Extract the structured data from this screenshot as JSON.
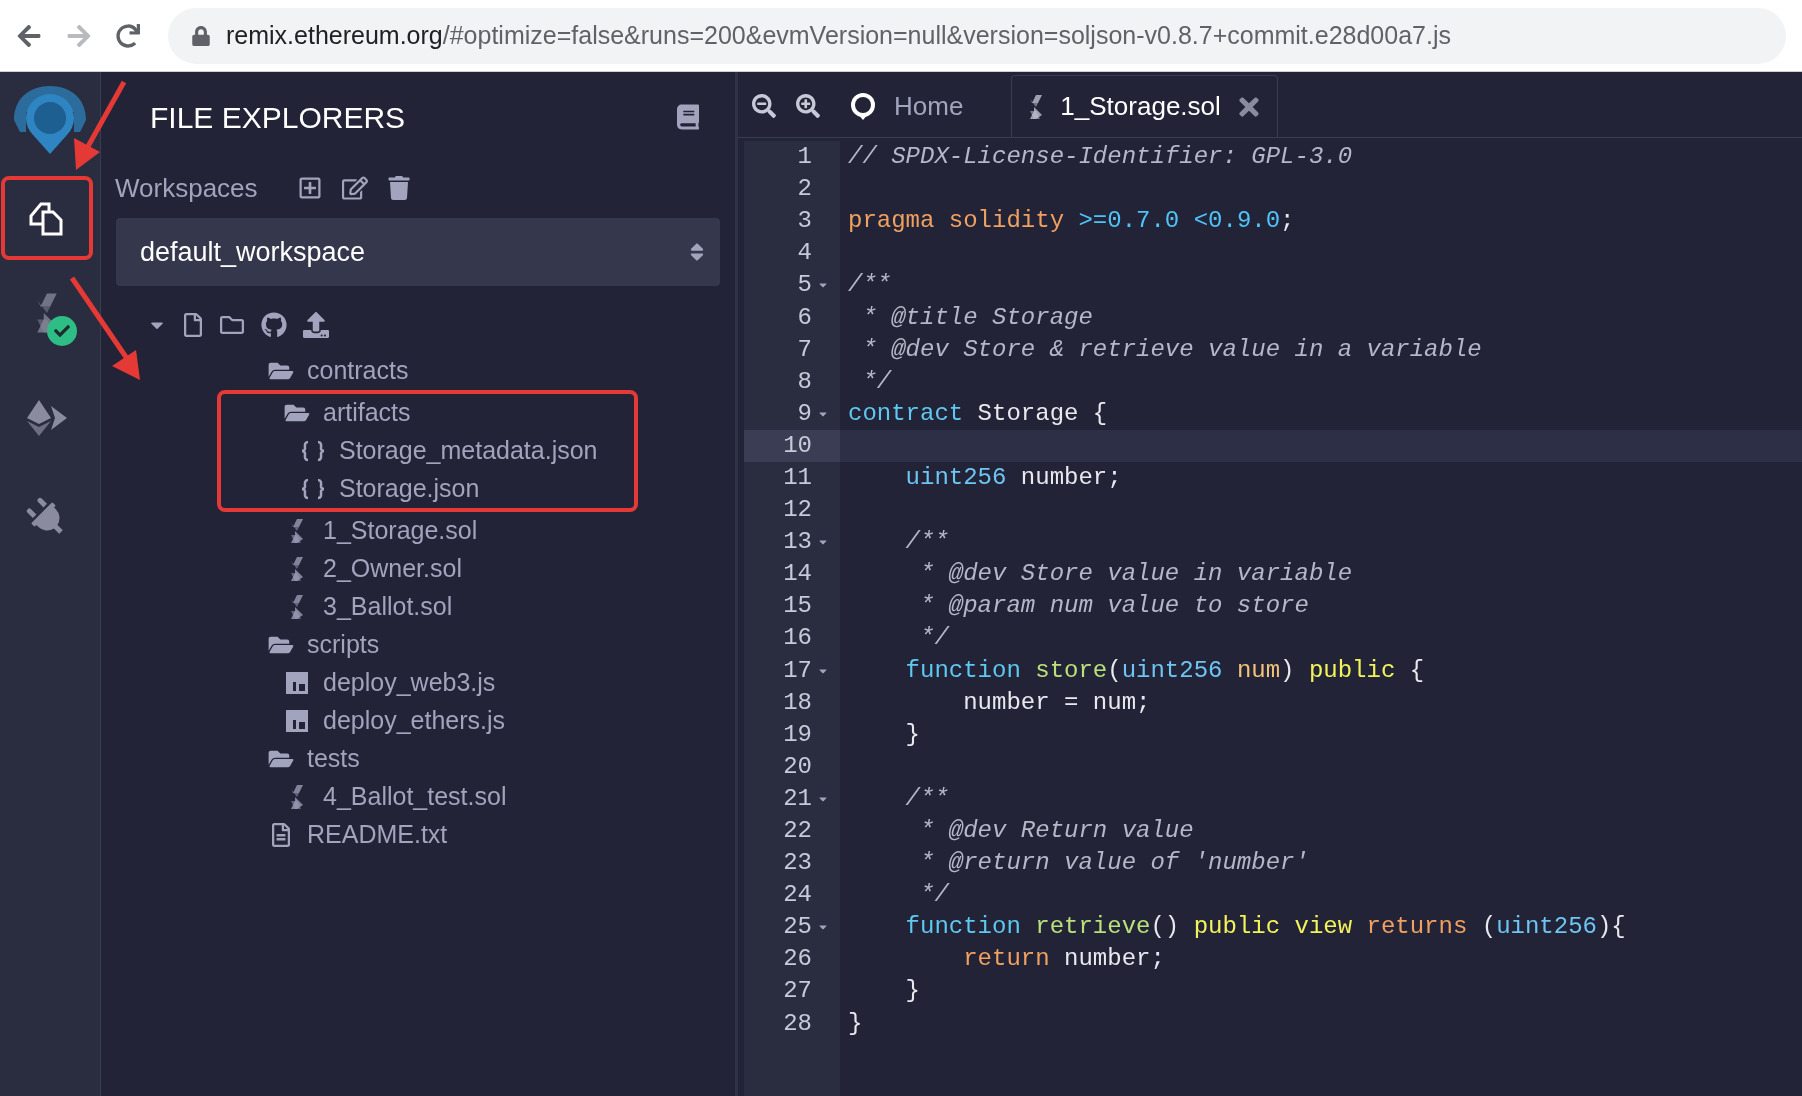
{
  "browser": {
    "url_host": "remix.ethereum.org",
    "url_rest": "/#optimize=false&runs=200&evmVersion=null&version=soljson-v0.8.7+commit.e28d00a7.js",
    "forward_disabled": true
  },
  "activity_bar": [
    {
      "kind": "files",
      "selected": true,
      "highlighted": true
    },
    {
      "kind": "compiler",
      "selected": false,
      "highlighted": false,
      "compiled": true
    },
    {
      "kind": "deploy",
      "selected": false,
      "highlighted": false
    },
    {
      "kind": "plugins",
      "selected": false,
      "highlighted": false
    }
  ],
  "side_panel": {
    "title": "FILE EXPLORERS",
    "workspaces_label": "Workspaces",
    "workspace": "default_workspace",
    "tree": [
      {
        "name": "contracts",
        "kind": "folder",
        "expanded": true,
        "highlighted": false,
        "children": [
          {
            "name": "artifacts",
            "kind": "folder",
            "expanded": true,
            "highlighted": true,
            "children": [
              {
                "name": "Storage_metadata.json",
                "kind": "json",
                "highlighted": false
              },
              {
                "name": "Storage.json",
                "kind": "json",
                "highlighted": false
              }
            ]
          },
          {
            "name": "1_Storage.sol",
            "kind": "sol",
            "highlighted": false
          },
          {
            "name": "2_Owner.sol",
            "kind": "sol",
            "highlighted": false
          },
          {
            "name": "3_Ballot.sol",
            "kind": "sol",
            "highlighted": false
          }
        ]
      },
      {
        "name": "scripts",
        "kind": "folder",
        "expanded": true,
        "highlighted": false,
        "children": [
          {
            "name": "deploy_web3.js",
            "kind": "js",
            "highlighted": false
          },
          {
            "name": "deploy_ethers.js",
            "kind": "js",
            "highlighted": false
          }
        ]
      },
      {
        "name": "tests",
        "kind": "folder",
        "expanded": true,
        "highlighted": false,
        "children": [
          {
            "name": "4_Ballot_test.sol",
            "kind": "sol",
            "highlighted": false
          }
        ]
      },
      {
        "name": "README.txt",
        "kind": "txt",
        "highlighted": false
      }
    ]
  },
  "tabs": [
    {
      "label": "Home",
      "kind": "home",
      "selected": false
    },
    {
      "label": "1_Storage.sol",
      "kind": "sol",
      "selected": true
    }
  ],
  "code": [
    {
      "number": "1",
      "foldable": false,
      "active": false,
      "tokens": [
        {
          "kind": "comment",
          "text": "// SPDX-License-Identifier: GPL-3.0"
        }
      ]
    },
    {
      "number": "2",
      "foldable": false,
      "active": false
    },
    {
      "number": "3",
      "foldable": false,
      "active": false,
      "tokens": [
        {
          "kind": "keyword",
          "text": "pragma solidity"
        },
        {
          "kind": "literal",
          "text": " >=0.7.0 <0.9.0"
        },
        {
          "kind": "plain",
          "text": ";"
        }
      ]
    },
    {
      "number": "4",
      "foldable": false,
      "active": false
    },
    {
      "number": "5",
      "foldable": true,
      "active": false,
      "tokens": [
        {
          "kind": "comment",
          "text": "/**"
        }
      ]
    },
    {
      "number": "6",
      "foldable": false,
      "active": false,
      "tokens": [
        {
          "kind": "comment",
          "text": " * @title Storage"
        }
      ]
    },
    {
      "number": "7",
      "foldable": false,
      "active": false,
      "tokens": [
        {
          "kind": "comment",
          "text": " * @dev Store & retrieve value in a variable"
        }
      ]
    },
    {
      "number": "8",
      "foldable": false,
      "active": false,
      "tokens": [
        {
          "kind": "comment",
          "text": " */"
        }
      ]
    },
    {
      "number": "9",
      "foldable": true,
      "active": false,
      "tokens": [
        {
          "kind": "storage",
          "text": "contract"
        },
        {
          "kind": "plain",
          "text": " Storage {"
        }
      ]
    },
    {
      "number": "10",
      "foldable": false,
      "active": true
    },
    {
      "number": "11",
      "foldable": false,
      "active": false,
      "tokens": [
        {
          "kind": "type",
          "text": "    uint256"
        },
        {
          "kind": "plain",
          "text": " number;"
        }
      ]
    },
    {
      "number": "12",
      "foldable": false,
      "active": false
    },
    {
      "number": "13",
      "foldable": true,
      "active": false,
      "tokens": [
        {
          "kind": "comment",
          "text": "    /**"
        }
      ]
    },
    {
      "number": "14",
      "foldable": false,
      "active": false,
      "tokens": [
        {
          "kind": "comment",
          "text": "     * @dev Store value in variable"
        }
      ]
    },
    {
      "number": "15",
      "foldable": false,
      "active": false,
      "tokens": [
        {
          "kind": "comment",
          "text": "     * @param num value to store"
        }
      ]
    },
    {
      "number": "16",
      "foldable": false,
      "active": false,
      "tokens": [
        {
          "kind": "comment",
          "text": "     */"
        }
      ]
    },
    {
      "number": "17",
      "foldable": true,
      "active": false,
      "tokens": [
        {
          "kind": "storage",
          "text": "    function"
        },
        {
          "kind": "func",
          "text": " store"
        },
        {
          "kind": "plain",
          "text": "("
        },
        {
          "kind": "type",
          "text": "uint256"
        },
        {
          "kind": "param",
          "text": " num"
        },
        {
          "kind": "plain",
          "text": ")"
        },
        {
          "kind": "modifier",
          "text": " public"
        },
        {
          "kind": "plain",
          "text": " {"
        }
      ]
    },
    {
      "number": "18",
      "foldable": false,
      "active": false,
      "tokens": [
        {
          "kind": "plain",
          "text": "        number = num;"
        }
      ]
    },
    {
      "number": "19",
      "foldable": false,
      "active": false,
      "tokens": [
        {
          "kind": "plain",
          "text": "    }"
        }
      ]
    },
    {
      "number": "20",
      "foldable": false,
      "active": false
    },
    {
      "number": "21",
      "foldable": true,
      "active": false,
      "tokens": [
        {
          "kind": "comment",
          "text": "    /**"
        }
      ]
    },
    {
      "number": "22",
      "foldable": false,
      "active": false,
      "tokens": [
        {
          "kind": "comment",
          "text": "     * @dev Return value"
        }
      ]
    },
    {
      "number": "23",
      "foldable": false,
      "active": false,
      "tokens": [
        {
          "kind": "comment",
          "text": "     * @return value of 'number'"
        }
      ]
    },
    {
      "number": "24",
      "foldable": false,
      "active": false,
      "tokens": [
        {
          "kind": "comment",
          "text": "     */"
        }
      ]
    },
    {
      "number": "25",
      "foldable": true,
      "active": false,
      "tokens": [
        {
          "kind": "storage",
          "text": "    function"
        },
        {
          "kind": "func",
          "text": " retrieve"
        },
        {
          "kind": "plain",
          "text": "()"
        },
        {
          "kind": "modifier",
          "text": " public view"
        },
        {
          "kind": "keyword",
          "text": " returns"
        },
        {
          "kind": "plain",
          "text": " ("
        },
        {
          "kind": "type",
          "text": "uint256"
        },
        {
          "kind": "plain",
          "text": "){"
        }
      ]
    },
    {
      "number": "26",
      "foldable": false,
      "active": false,
      "tokens": [
        {
          "kind": "keyword",
          "text": "        return"
        },
        {
          "kind": "plain",
          "text": " number;"
        }
      ]
    },
    {
      "number": "27",
      "foldable": false,
      "active": false,
      "tokens": [
        {
          "kind": "plain",
          "text": "    }"
        }
      ]
    },
    {
      "number": "28",
      "foldable": false,
      "active": false,
      "tokens": [
        {
          "kind": "plain",
          "text": "}"
        }
      ]
    }
  ]
}
